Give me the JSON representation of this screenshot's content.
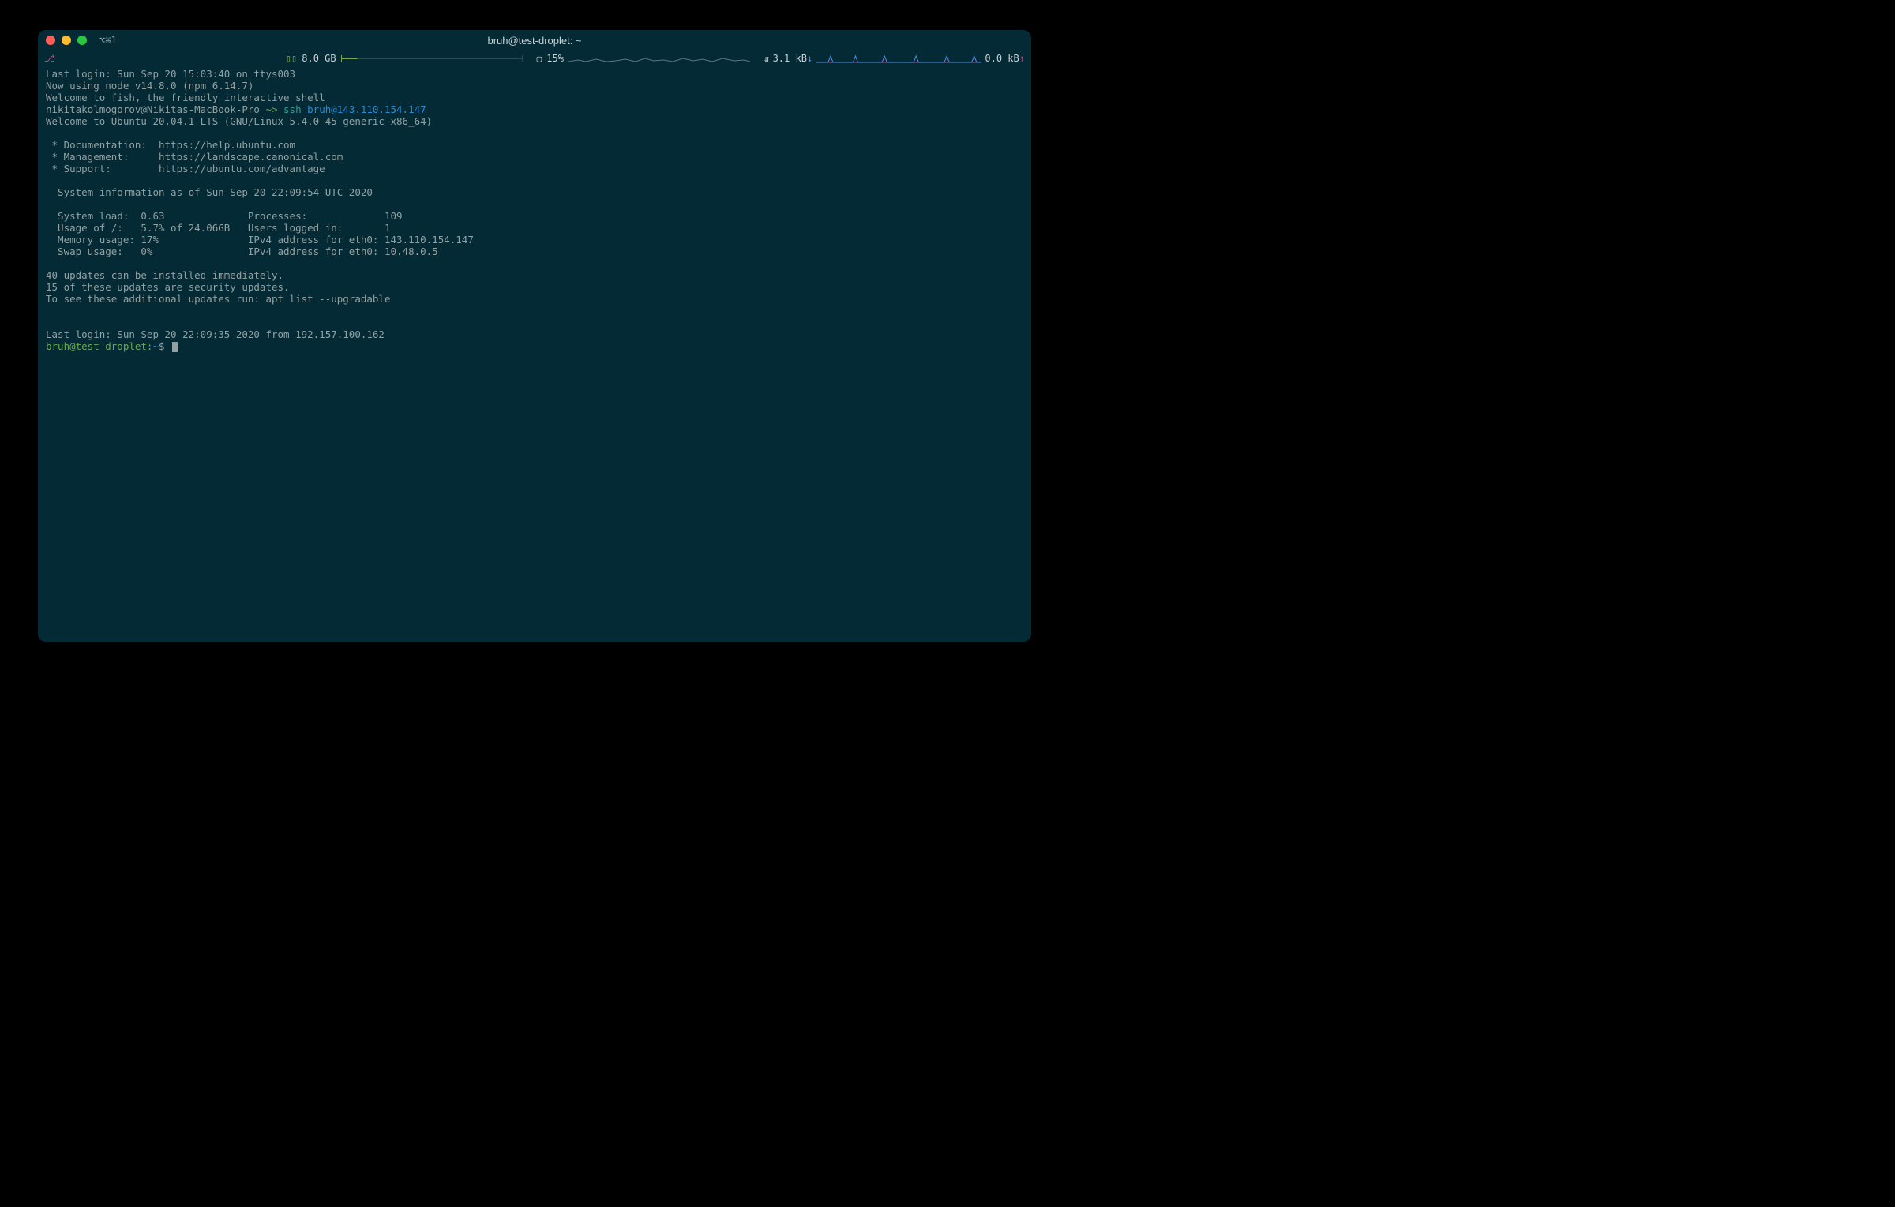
{
  "titlebar": {
    "tab_label": "⌥⌘1",
    "window_title": "bruh@test-droplet: ~"
  },
  "status": {
    "branch_symbol": "⎇",
    "mem_icon": "▯▯",
    "mem_label": "8.0 GB",
    "cpu_icon": "▢",
    "cpu_label": "15%",
    "net_icon": "⇵",
    "net_down": "3.1 kB",
    "net_down_arrow": "↓",
    "net_up": "0.0 kB",
    "net_up_arrow": "↑"
  },
  "terminal": {
    "l1": "Last login: Sun Sep 20 15:03:40 on ttys003",
    "l2": "Now using node v14.8.0 (npm 6.14.7)",
    "l3": "Welcome to fish, the friendly interactive shell",
    "prompt1_user": "nikitakolmogorov@Nikitas-MacBook-Pro ",
    "prompt1_tilde": "~> ",
    "prompt1_cmd": "ssh ",
    "prompt1_arg": "bruh@143.110.154.147",
    "l5": "Welcome to Ubuntu 20.04.1 LTS (GNU/Linux 5.4.0-45-generic x86_64)",
    "l6": "",
    "l7": " * Documentation:  https://help.ubuntu.com",
    "l8": " * Management:     https://landscape.canonical.com",
    "l9": " * Support:        https://ubuntu.com/advantage",
    "l10": "",
    "l11": "  System information as of Sun Sep 20 22:09:54 UTC 2020",
    "l12": "",
    "l13": "  System load:  0.63              Processes:             109",
    "l14": "  Usage of /:   5.7% of 24.06GB   Users logged in:       1",
    "l15": "  Memory usage: 17%               IPv4 address for eth0: 143.110.154.147",
    "l16": "  Swap usage:   0%                IPv4 address for eth0: 10.48.0.5",
    "l17": "",
    "l18": "40 updates can be installed immediately.",
    "l19": "15 of these updates are security updates.",
    "l20": "To see these additional updates run: apt list --upgradable",
    "l21": "",
    "l22": "",
    "l23": "Last login: Sun Sep 20 22:09:35 2020 from 192.157.100.162",
    "prompt2": "bruh@test-droplet:",
    "prompt2_path": "~",
    "prompt2_dollar": "$ "
  }
}
